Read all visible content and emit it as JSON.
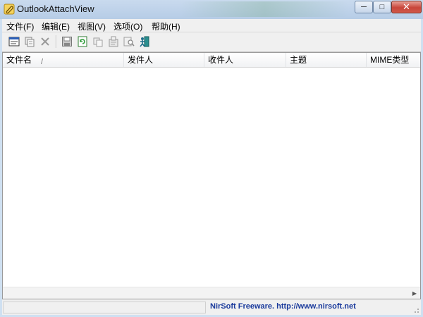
{
  "window": {
    "title": "OutlookAttachView",
    "min_glyph": "─",
    "max_glyph": "□",
    "close_glyph": "✕",
    "app_icon": "paperclip-icon"
  },
  "menu": {
    "items": [
      {
        "label": "文件(F)"
      },
      {
        "label": "编辑(E)"
      },
      {
        "label": "视图(V)"
      },
      {
        "label": "选项(O)"
      },
      {
        "label": "帮助(H)"
      }
    ]
  },
  "toolbar": {
    "buttons": [
      {
        "icon": "html-report-icon"
      },
      {
        "icon": "copy-selected-icon"
      },
      {
        "icon": "delete-icon"
      },
      {
        "icon": "save-icon"
      },
      {
        "icon": "refresh-icon"
      },
      {
        "icon": "copy-icon"
      },
      {
        "icon": "properties-icon"
      },
      {
        "icon": "find-icon"
      },
      {
        "icon": "exit-icon"
      }
    ]
  },
  "list": {
    "columns": [
      {
        "label": "文件名",
        "sort_indicator": "/"
      },
      {
        "label": "发件人"
      },
      {
        "label": "收件人"
      },
      {
        "label": "主题"
      },
      {
        "label": "MIME类型"
      }
    ],
    "rows": []
  },
  "status": {
    "left_text": "",
    "link_text": "NirSoft Freeware.  http://www.nirsoft.net"
  },
  "colors": {
    "titlebar": "#c9daee",
    "close_button": "#c8463a",
    "link": "#1a3a9c"
  }
}
